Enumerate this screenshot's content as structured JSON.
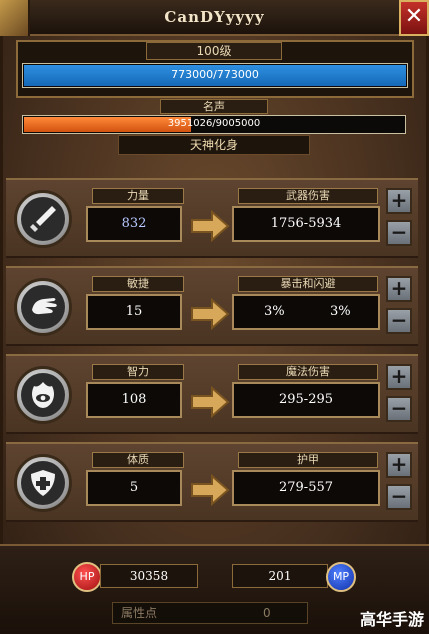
{
  "header": {
    "player_name": "CanDYyyyy",
    "close_icon": "close-x-icon"
  },
  "level": {
    "label": "100级",
    "xp_text": "773000/773000",
    "xp_fraction": 1.0
  },
  "fame": {
    "label": "名声",
    "text": "3951026/9005000",
    "fraction": 0.4388,
    "rank": "天神化身"
  },
  "stats": [
    {
      "icon": "sword-icon",
      "label": "力量",
      "value": "832",
      "value_color": "#b8c8ff",
      "derived_label": "武器伤害",
      "derived_value": "1756-5934"
    },
    {
      "icon": "agility-hand-icon",
      "label": "敏捷",
      "value": "15",
      "value_color": "#ffffff",
      "derived_label": "暴击和闪避",
      "derived_value_a": "3%",
      "derived_value_b": "3%"
    },
    {
      "icon": "fire-eye-icon",
      "label": "智力",
      "value": "108",
      "value_color": "#ffffff",
      "derived_label": "魔法伤害",
      "derived_value": "295-295"
    },
    {
      "icon": "shield-cross-icon",
      "label": "体质",
      "value": "5",
      "value_color": "#ffffff",
      "derived_label": "护甲",
      "derived_value": "279-557"
    }
  ],
  "buttons": {
    "plus": "+",
    "minus": "−"
  },
  "vitals": {
    "hp_label": "HP",
    "hp_value": "30358",
    "mp_label": "MP",
    "mp_value": "201"
  },
  "attribute_points": {
    "label": "属性点",
    "value": "0"
  },
  "watermark": "高华手游",
  "colors": {
    "xp": "#1e7fd6",
    "fame": "#ee6a1e",
    "hp": "#d01818",
    "mp": "#1848d8"
  }
}
